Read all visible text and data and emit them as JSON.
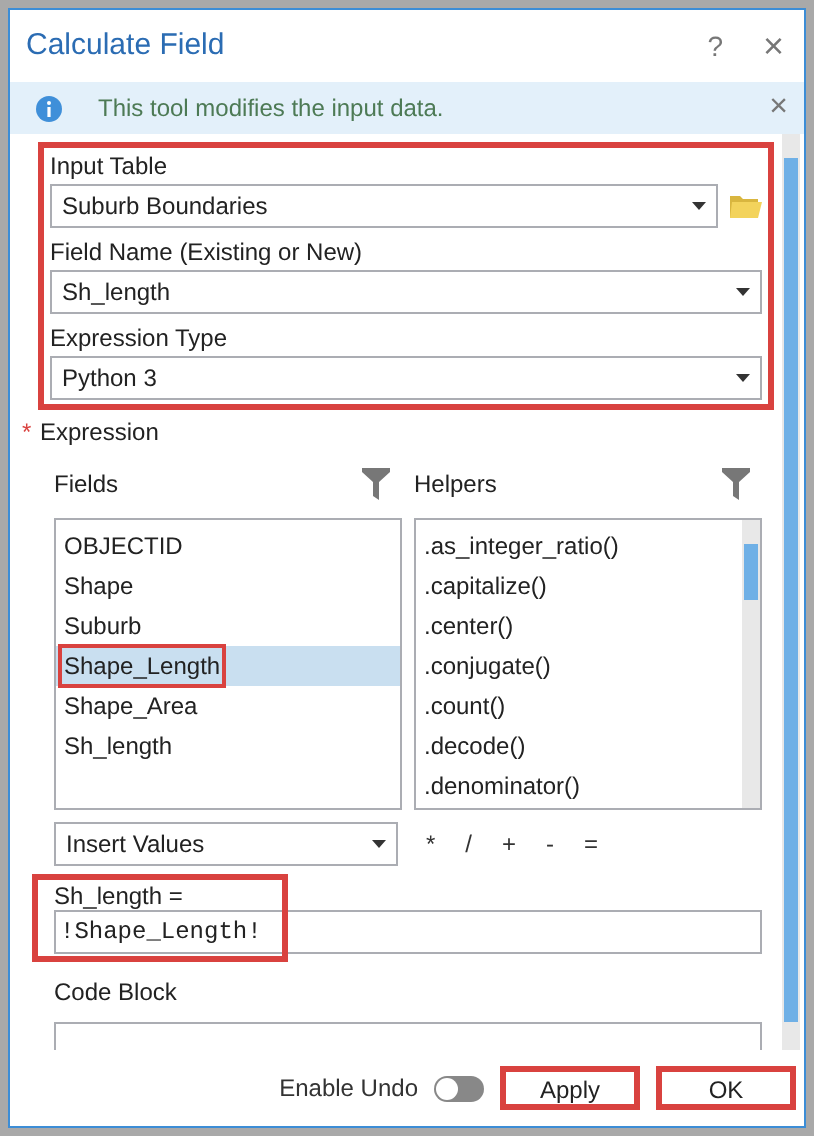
{
  "window": {
    "title": "Calculate Field",
    "help": "?",
    "close": "×"
  },
  "info_bar": {
    "message": "This tool modifies the input data.",
    "close": "×"
  },
  "input_table": {
    "label": "Input Table",
    "value": "Suburb Boundaries"
  },
  "field_name": {
    "label": "Field Name (Existing or New)",
    "value": "Sh_length"
  },
  "expression_type": {
    "label": "Expression Type",
    "value": "Python 3"
  },
  "expression": {
    "required_mark": "*",
    "label": "Expression",
    "fields": {
      "label": "Fields",
      "items": [
        {
          "label": "OBJECTID",
          "selected": false
        },
        {
          "label": "Shape",
          "selected": false
        },
        {
          "label": "Suburb",
          "selected": false
        },
        {
          "label": "Shape_Length",
          "selected": true
        },
        {
          "label": "Shape_Area",
          "selected": false
        },
        {
          "label": "Sh_length",
          "selected": false
        }
      ]
    },
    "helpers": {
      "label": "Helpers",
      "items": [
        ".as_integer_ratio()",
        ".capitalize()",
        ".center()",
        ".conjugate()",
        ".count()",
        ".decode()",
        ".denominator()"
      ]
    },
    "insert_values": "Insert Values",
    "operators": [
      "*",
      "/",
      "+",
      "-",
      "="
    ],
    "target_label": "Sh_length =",
    "value": "!Shape_Length!"
  },
  "code_block": {
    "label": "Code Block"
  },
  "footer": {
    "enable_undo": {
      "label": "Enable Undo",
      "on": false
    },
    "buttons": [
      "Apply",
      "OK"
    ]
  }
}
